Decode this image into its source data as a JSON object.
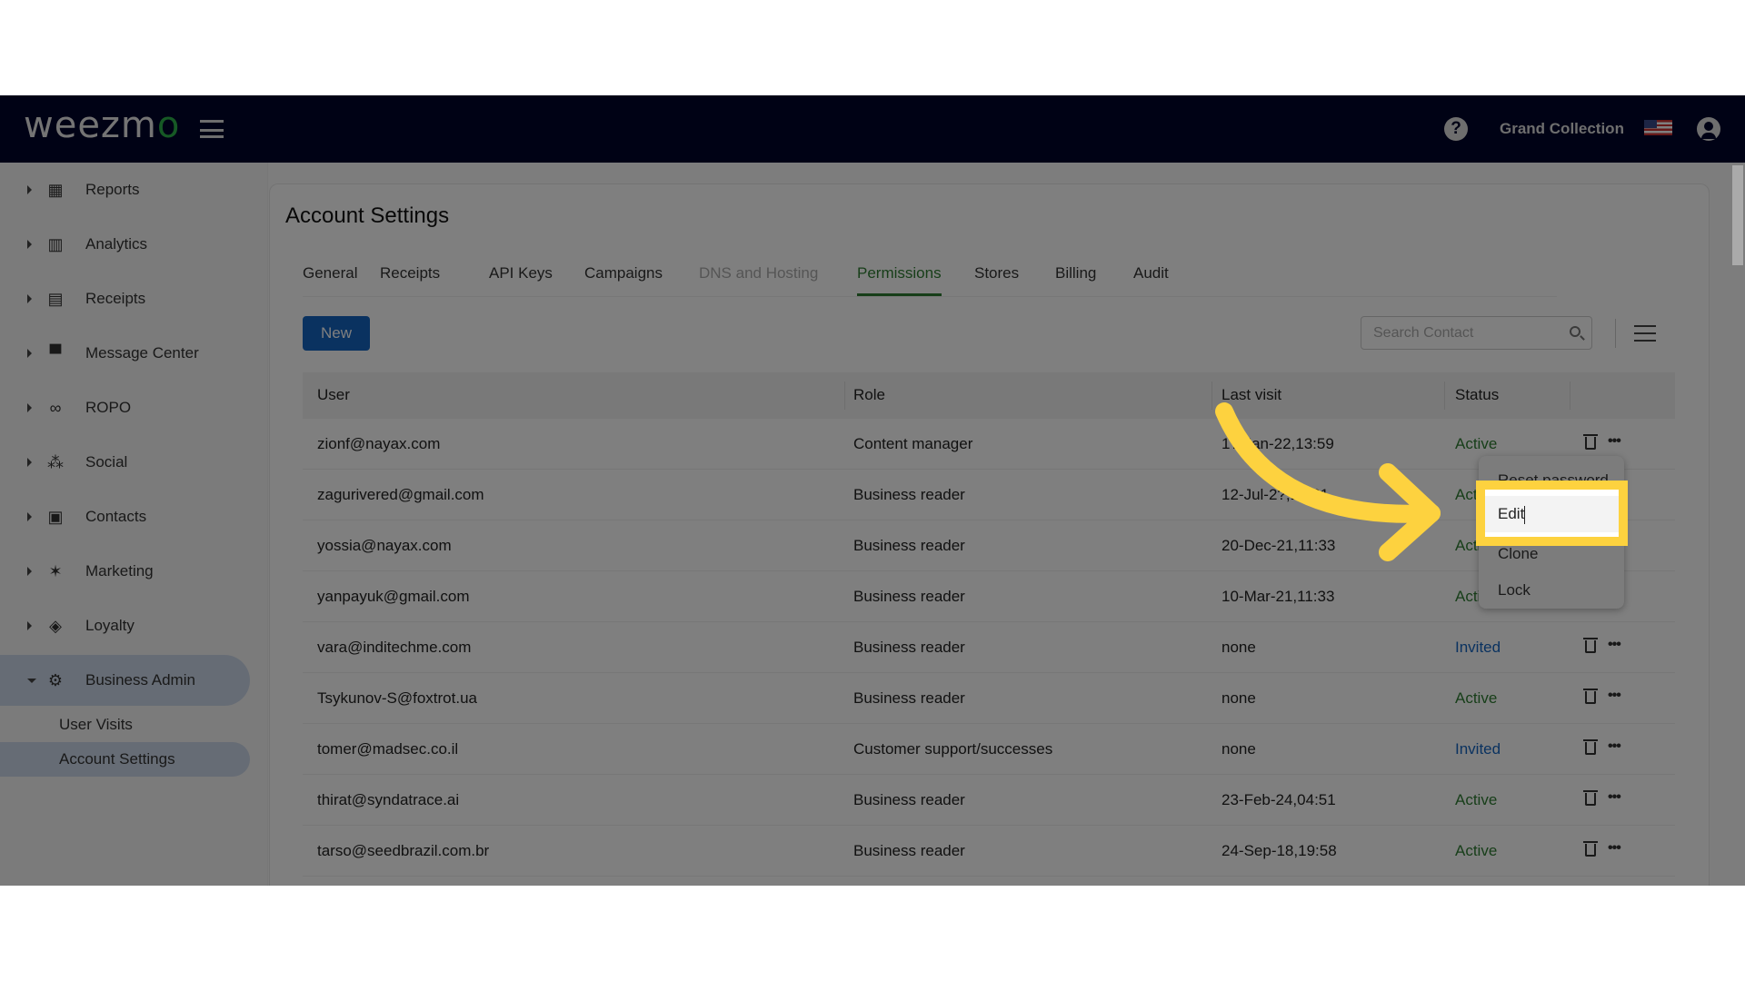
{
  "header": {
    "logo": "weezmo",
    "org_name": "Grand Collection"
  },
  "sidebar": {
    "items": [
      {
        "label": "Reports",
        "icon": "dashboard-icon"
      },
      {
        "label": "Analytics",
        "icon": "bar-chart-icon"
      },
      {
        "label": "Receipts",
        "icon": "receipt-icon"
      },
      {
        "label": "Message Center",
        "icon": "chat-icon"
      },
      {
        "label": "ROPO",
        "icon": "infinity-icon"
      },
      {
        "label": "Social",
        "icon": "people-icon"
      },
      {
        "label": "Contacts",
        "icon": "contact-card-icon"
      },
      {
        "label": "Marketing",
        "icon": "party-popper-icon"
      },
      {
        "label": "Loyalty",
        "icon": "tag-heart-icon"
      },
      {
        "label": "Business Admin",
        "icon": "gear-icon"
      }
    ],
    "sub_items": [
      {
        "label": "User Visits"
      },
      {
        "label": "Account Settings"
      }
    ]
  },
  "page": {
    "title": "Account Settings",
    "tabs": [
      "General",
      "Receipts",
      "API Keys",
      "Campaigns",
      "DNS and Hosting",
      "Permissions",
      "Stores",
      "Billing",
      "Audit"
    ],
    "active_tab": "Permissions",
    "new_label": "New",
    "search_placeholder": "Search Contact"
  },
  "table": {
    "columns": [
      "User",
      "Role",
      "Last visit",
      "Status"
    ],
    "rows": [
      {
        "user": "zionf@nayax.com",
        "role": "Content manager",
        "last": "1?-Jan-22,13:59",
        "status": "Active"
      },
      {
        "user": "zagurivered@gmail.com",
        "role": "Business reader",
        "last": "12-Jul-2?,10:31",
        "status": "Active"
      },
      {
        "user": "yossia@nayax.com",
        "role": "Business reader",
        "last": "20-Dec-21,11:33",
        "status": "Active"
      },
      {
        "user": "yanpayuk@gmail.com",
        "role": "Business reader",
        "last": "10-Mar-21,11:33",
        "status": "Active"
      },
      {
        "user": "vara@inditechme.com",
        "role": "Business reader",
        "last": "none",
        "status": "Invited"
      },
      {
        "user": "Tsykunov-S@foxtrot.ua",
        "role": "Business reader",
        "last": "none",
        "status": "Active"
      },
      {
        "user": "tomer@madsec.co.il",
        "role": "Customer support/successes",
        "last": "none",
        "status": "Invited"
      },
      {
        "user": "thirat@syndatrace.ai",
        "role": "Business reader",
        "last": "23-Feb-24,04:51",
        "status": "Active"
      },
      {
        "user": "tarso@seedbrazil.com.br",
        "role": "Business reader",
        "last": "24-Sep-18,19:58",
        "status": "Active"
      }
    ]
  },
  "menu": {
    "items": [
      "Reset password",
      "Edit",
      "Clone",
      "Lock"
    ],
    "highlighted": "Edit"
  },
  "colors": {
    "header": "#00052a",
    "accent": "#2e7d32",
    "primary": "#1565c0",
    "highlight": "#fdd23f"
  }
}
